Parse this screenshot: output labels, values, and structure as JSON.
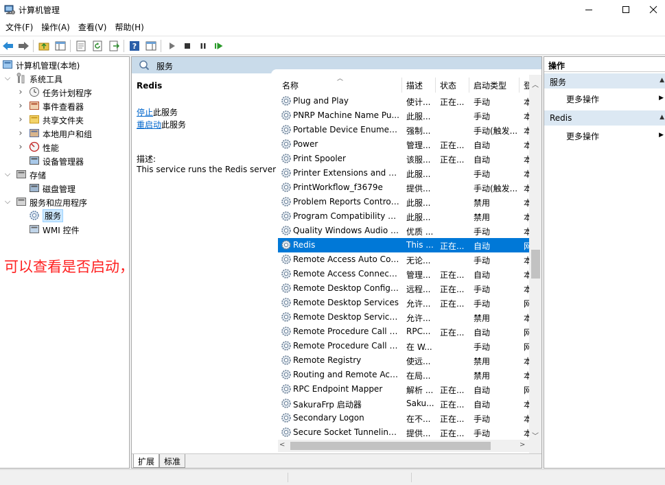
{
  "window": {
    "title": "计算机管理"
  },
  "menu": [
    "文件(F)",
    "操作(A)",
    "查看(V)",
    "帮助(H)"
  ],
  "tree": [
    {
      "label": "计算机管理(本地)",
      "level": 0,
      "twisty": "",
      "icon": "computer-management-icon"
    },
    {
      "label": "系统工具",
      "level": 1,
      "twisty": "v",
      "icon": "tools-icon"
    },
    {
      "label": "任务计划程序",
      "level": 2,
      "twisty": ">",
      "icon": "clock-icon"
    },
    {
      "label": "事件查看器",
      "level": 2,
      "twisty": ">",
      "icon": "event-viewer-icon"
    },
    {
      "label": "共享文件夹",
      "level": 2,
      "twisty": ">",
      "icon": "shared-folder-icon"
    },
    {
      "label": "本地用户和组",
      "level": 2,
      "twisty": ">",
      "icon": "users-icon"
    },
    {
      "label": "性能",
      "level": 2,
      "twisty": ">",
      "icon": "performance-icon"
    },
    {
      "label": "设备管理器",
      "level": 2,
      "twisty": "",
      "icon": "device-manager-icon"
    },
    {
      "label": "存储",
      "level": 1,
      "twisty": "v",
      "icon": "storage-icon"
    },
    {
      "label": "磁盘管理",
      "level": 2,
      "twisty": "",
      "icon": "disk-icon"
    },
    {
      "label": "服务和应用程序",
      "level": 1,
      "twisty": "v",
      "icon": "services-apps-icon"
    },
    {
      "label": "服务",
      "level": 2,
      "twisty": "",
      "icon": "gear-icon",
      "selected": true
    },
    {
      "label": "WMI 控件",
      "level": 2,
      "twisty": "",
      "icon": "wmi-icon"
    }
  ],
  "annotation": "可以查看是否启动，未启动就点击启动",
  "services_header": "服务",
  "detail": {
    "name": "Redis",
    "stop_link": "停止",
    "stop_suffix": "此服务",
    "restart_link": "重启动",
    "restart_suffix": "此服务",
    "desc_label": "描述:",
    "desc_text": "This service runs the Redis server"
  },
  "columns": [
    "名称",
    "描述",
    "状态",
    "启动类型",
    "登"
  ],
  "services": [
    {
      "name": "Plug and Play",
      "desc": "使计...",
      "state": "正在...",
      "start": "手动",
      "logon": "本"
    },
    {
      "name": "PNRP Machine Name Pu...",
      "desc": "此服...",
      "state": "",
      "start": "手动",
      "logon": "本"
    },
    {
      "name": "Portable Device Enumera...",
      "desc": "强制...",
      "state": "",
      "start": "手动(触发...",
      "logon": "本"
    },
    {
      "name": "Power",
      "desc": "管理...",
      "state": "正在...",
      "start": "自动",
      "logon": "本"
    },
    {
      "name": "Print Spooler",
      "desc": "该服...",
      "state": "正在...",
      "start": "自动",
      "logon": "本"
    },
    {
      "name": "Printer Extensions and N...",
      "desc": "此服...",
      "state": "",
      "start": "手动",
      "logon": "本"
    },
    {
      "name": "PrintWorkflow_f3679e",
      "desc": "提供...",
      "state": "",
      "start": "手动(触发...",
      "logon": "本"
    },
    {
      "name": "Problem Reports Control...",
      "desc": "此服...",
      "state": "",
      "start": "禁用",
      "logon": "本"
    },
    {
      "name": "Program Compatibility A...",
      "desc": "此服...",
      "state": "",
      "start": "禁用",
      "logon": "本"
    },
    {
      "name": "Quality Windows Audio V...",
      "desc": "优质 ...",
      "state": "",
      "start": "手动",
      "logon": "本"
    },
    {
      "name": "Redis",
      "desc": "This ...",
      "state": "正在...",
      "start": "自动",
      "logon": "网",
      "selected": true
    },
    {
      "name": "Remote Access Auto Con...",
      "desc": "无论...",
      "state": "",
      "start": "手动",
      "logon": "本"
    },
    {
      "name": "Remote Access Connecti...",
      "desc": "管理...",
      "state": "正在...",
      "start": "自动",
      "logon": "本"
    },
    {
      "name": "Remote Desktop Configu...",
      "desc": "远程...",
      "state": "正在...",
      "start": "手动",
      "logon": "本"
    },
    {
      "name": "Remote Desktop Services",
      "desc": "允许...",
      "state": "正在...",
      "start": "手动",
      "logon": "网"
    },
    {
      "name": "Remote Desktop Service...",
      "desc": "允许...",
      "state": "",
      "start": "禁用",
      "logon": "本"
    },
    {
      "name": "Remote Procedure Call (...",
      "desc": "RPC...",
      "state": "正在...",
      "start": "自动",
      "logon": "网"
    },
    {
      "name": "Remote Procedure Call (...",
      "desc": "在 W...",
      "state": "",
      "start": "手动",
      "logon": "网"
    },
    {
      "name": "Remote Registry",
      "desc": "使远...",
      "state": "",
      "start": "禁用",
      "logon": "本"
    },
    {
      "name": "Routing and Remote Acc...",
      "desc": "在局...",
      "state": "",
      "start": "禁用",
      "logon": "本"
    },
    {
      "name": "RPC Endpoint Mapper",
      "desc": "解析 ...",
      "state": "正在...",
      "start": "自动",
      "logon": "网"
    },
    {
      "name": "SakuraFrp 启动器",
      "desc": "Saku...",
      "state": "正在...",
      "start": "自动",
      "logon": "本"
    },
    {
      "name": "Secondary Logon",
      "desc": "在不...",
      "state": "正在...",
      "start": "手动",
      "logon": "本"
    },
    {
      "name": "Secure Socket Tunneling ...",
      "desc": "提供...",
      "state": "正在...",
      "start": "手动",
      "logon": "本"
    }
  ],
  "tabs": [
    "扩展",
    "标准"
  ],
  "actions": {
    "title": "操作",
    "sections": [
      {
        "header": "服务",
        "item": "更多操作"
      },
      {
        "header": "Redis",
        "item": "更多操作"
      }
    ]
  },
  "colors": {
    "selection": "#0078d7",
    "annotation": "#ff2020",
    "link": "#0066cc",
    "pane_header": "#c9dbea"
  }
}
